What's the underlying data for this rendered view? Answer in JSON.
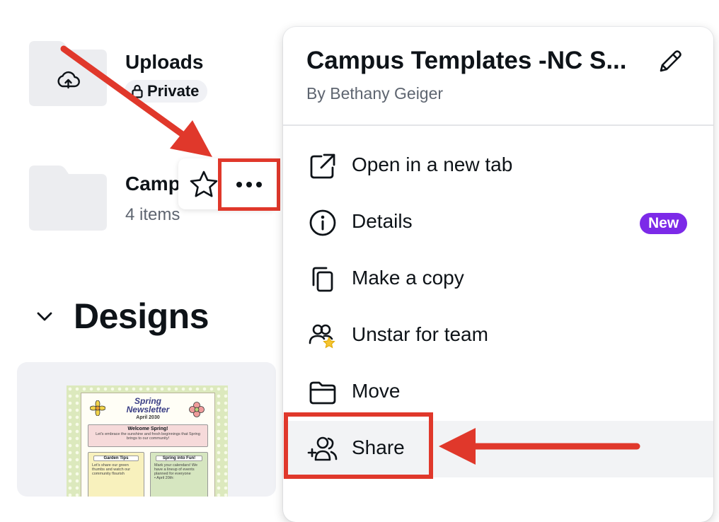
{
  "folders": [
    {
      "title": "Uploads",
      "badge": "Private"
    },
    {
      "title": "Camp",
      "count": "4 items"
    }
  ],
  "sections": {
    "designs_title": "Designs"
  },
  "newsletter": {
    "title_line1": "Spring",
    "title_line2": "Newsletter",
    "date": "April 2030",
    "welcome_heading": "Welcome Spring!",
    "welcome_body": "Let's embrace the sunshine and fresh beginnings that Spring brings to our community!",
    "box1_heading": "Garden Tips",
    "box1_body": "Let's share our green thumbs and watch our community flourish",
    "box2_heading": "Spring into Fun!",
    "box2_body": "Mark your calendars! We have a lineup of events planned for everyone",
    "box2_bullet": "• April 20th:"
  },
  "menu": {
    "title": "Campus Templates -NC S...",
    "owner": "By Bethany Geiger",
    "items": [
      {
        "label": "Open in a new tab",
        "icon": "external-link-icon"
      },
      {
        "label": "Details",
        "icon": "info-icon",
        "badge": "New"
      },
      {
        "label": "Make a copy",
        "icon": "copy-icon"
      },
      {
        "label": "Unstar for team",
        "icon": "team-star-icon"
      },
      {
        "label": "Move",
        "icon": "folder-icon"
      },
      {
        "label": "Share",
        "icon": "add-user-icon"
      }
    ]
  },
  "colors": {
    "annotation_red": "#e0382b",
    "new_badge": "#7c2ae8",
    "folder_gray": "#ecedf0",
    "text_primary": "#0e1318",
    "text_secondary": "#5e6570"
  }
}
